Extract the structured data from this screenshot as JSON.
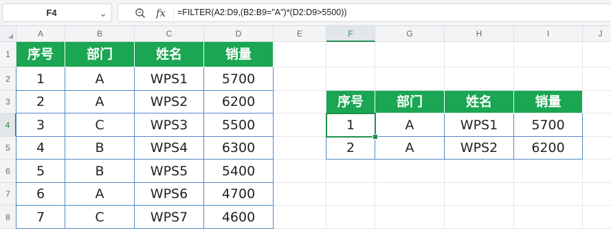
{
  "formula_bar": {
    "name_box": "F4",
    "zoom_icon": "zoom-icon",
    "fx_label": "fx",
    "formula": "=FILTER(A2:D9,(B2:B9=\"A\")*(D2:D9>5500))"
  },
  "columns": [
    "A",
    "B",
    "C",
    "D",
    "E",
    "F",
    "G",
    "H",
    "I",
    "J"
  ],
  "rows": [
    "1",
    "2",
    "3",
    "4",
    "5",
    "6",
    "7",
    "8"
  ],
  "selected_cell": "F4",
  "colors": {
    "header_green": "#1aa652",
    "table_border": "#4f86c6",
    "selection": "#1f8e4b"
  },
  "source_table": {
    "headers": [
      "序号",
      "部门",
      "姓名",
      "销量"
    ],
    "rows": [
      [
        "1",
        "A",
        "WPS1",
        "5700"
      ],
      [
        "2",
        "A",
        "WPS2",
        "6200"
      ],
      [
        "3",
        "C",
        "WPS3",
        "5500"
      ],
      [
        "4",
        "B",
        "WPS4",
        "6300"
      ],
      [
        "5",
        "B",
        "WPS5",
        "5400"
      ],
      [
        "6",
        "A",
        "WPS6",
        "4700"
      ],
      [
        "7",
        "C",
        "WPS7",
        "4600"
      ]
    ]
  },
  "result_table": {
    "headers": [
      "序号",
      "部门",
      "姓名",
      "销量"
    ],
    "rows": [
      [
        "1",
        "A",
        "WPS1",
        "5700"
      ],
      [
        "2",
        "A",
        "WPS2",
        "6200"
      ]
    ]
  }
}
